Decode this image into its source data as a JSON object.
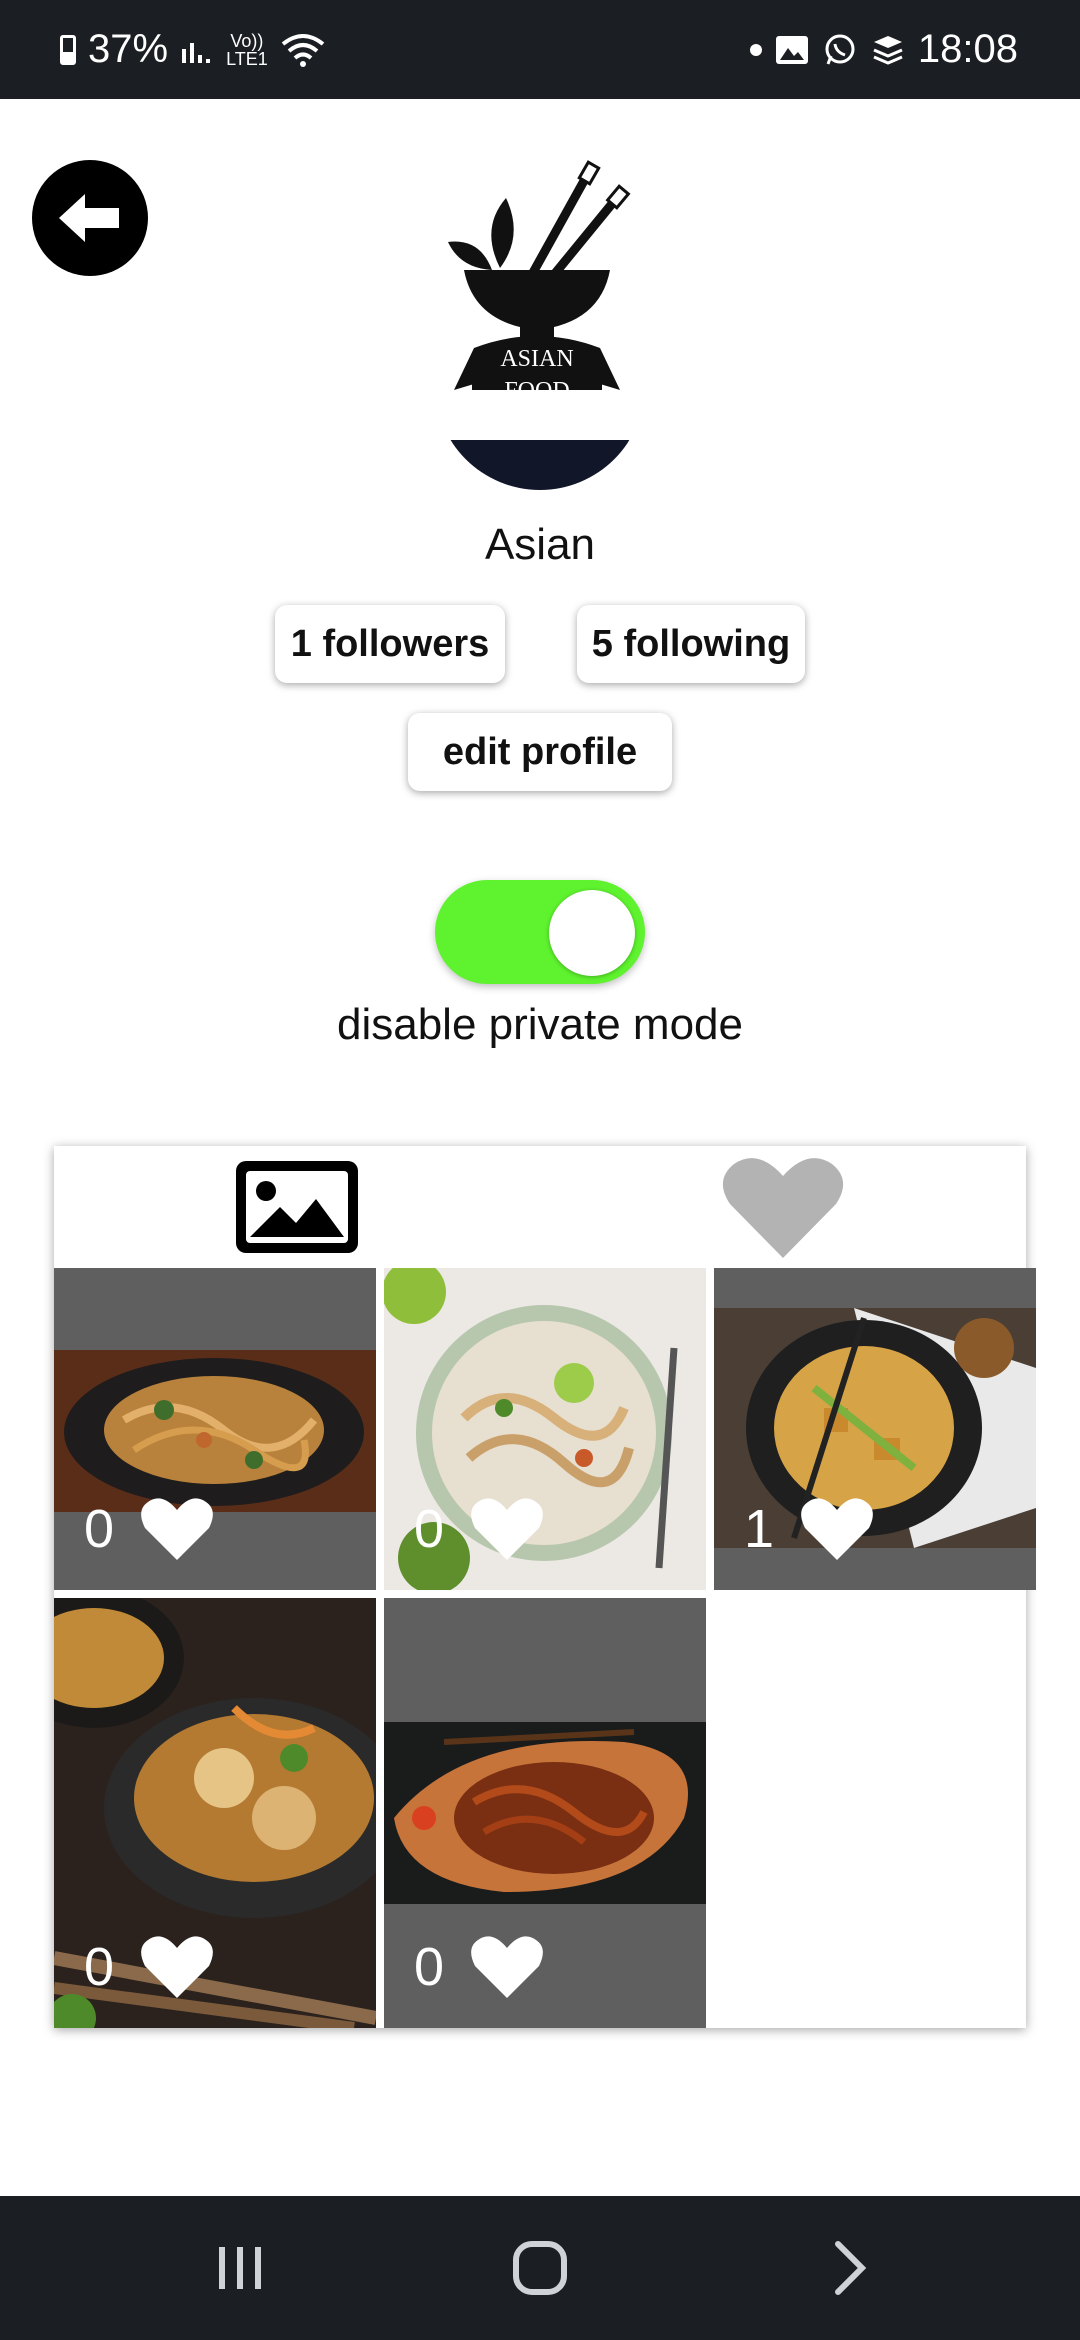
{
  "status_bar": {
    "battery": "37%",
    "network_line1": "Vo))",
    "network_line2": "LTE1",
    "time": "18:08",
    "icons": [
      "battery-icon",
      "signal-icon",
      "wifi-icon",
      "dot-icon",
      "gallery-notification-icon",
      "whatsapp-icon",
      "stack-icon"
    ]
  },
  "profile": {
    "logo_line1": "ASIAN",
    "logo_line2": "FOOD",
    "name": "Asian",
    "followers_label": "1 followers",
    "following_label": "5 following",
    "edit_label": "edit profile"
  },
  "private_mode": {
    "enabled": true,
    "label": "disable private mode",
    "on_color": "#5ef32e"
  },
  "tabs": [
    {
      "icon": "image-icon",
      "active": true
    },
    {
      "icon": "heart-icon",
      "active": false
    }
  ],
  "posts": [
    {
      "likes": "0",
      "description": "stir-fried noodles in a wok"
    },
    {
      "likes": "0",
      "description": "pad thai in a bowl with lime"
    },
    {
      "likes": "1",
      "description": "noodles with tofu and chopsticks"
    },
    {
      "likes": "0",
      "description": "glazed fish with herbs"
    },
    {
      "likes": "0",
      "description": "fried noodles on a wooden plate"
    }
  ],
  "colors": {
    "status_bar": "#1b1e22",
    "nav_bar": "#1b1e22",
    "cell_background": "#5f5f5f",
    "inactive_tab": "#b3b3b3"
  },
  "nav_bar": {
    "icons": [
      "recent-apps-icon",
      "home-icon",
      "back-nav-icon"
    ]
  }
}
